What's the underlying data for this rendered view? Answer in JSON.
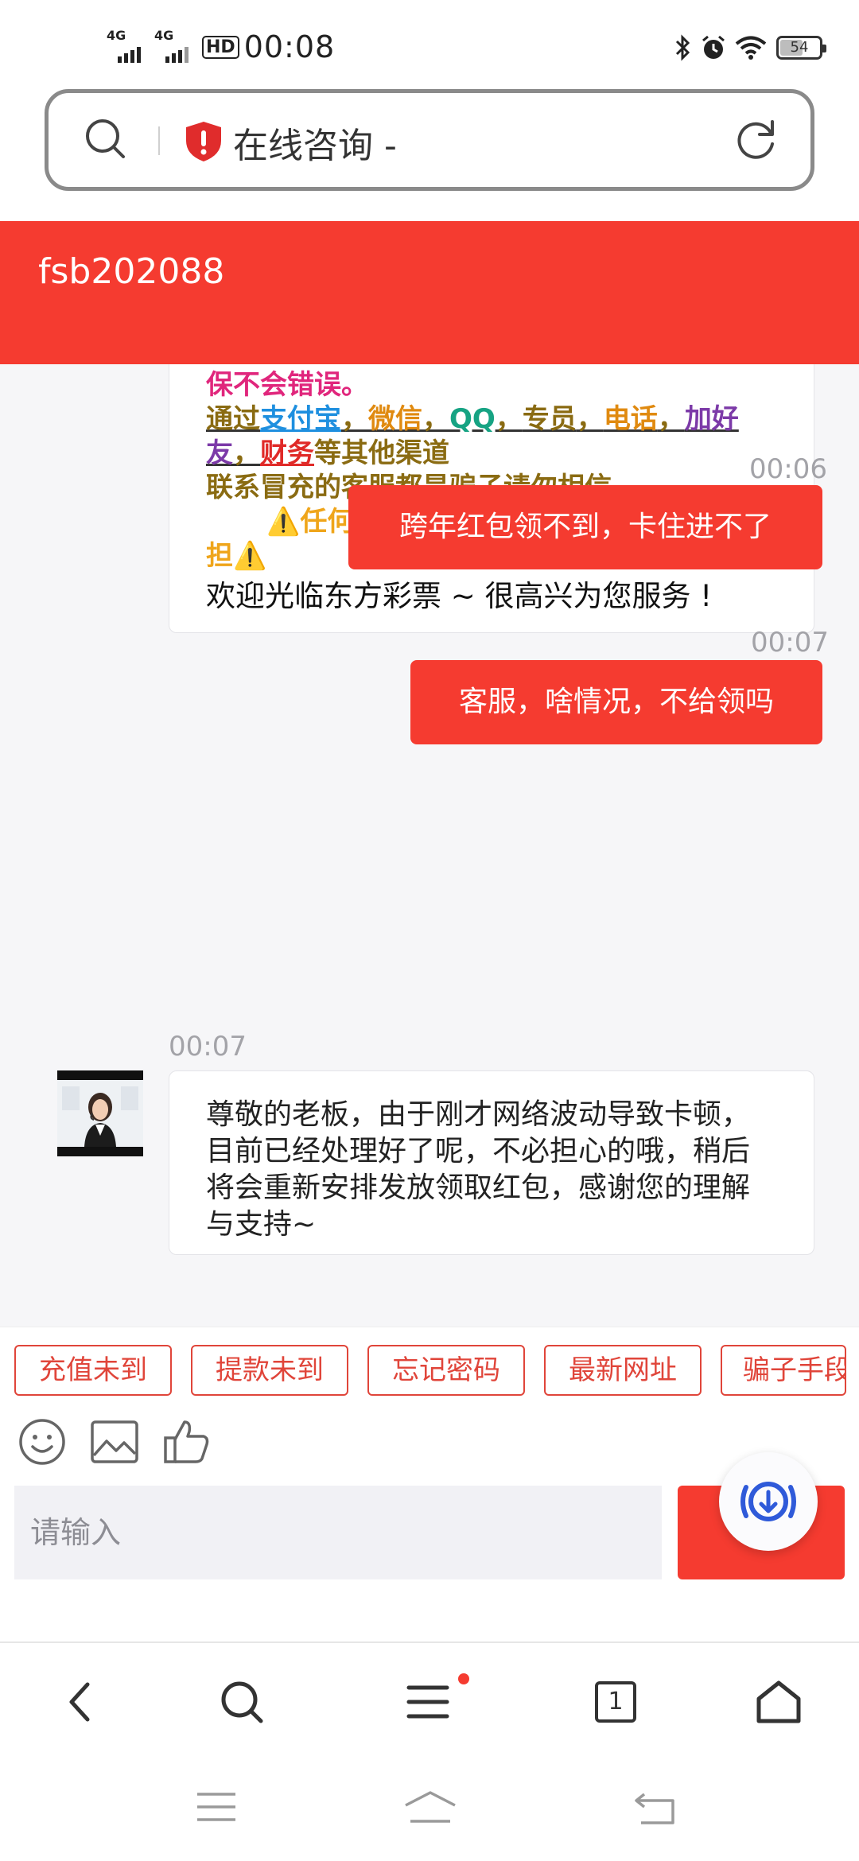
{
  "status_bar": {
    "signal1": "4G",
    "signal2": "4G",
    "hd": "HD",
    "time": "00:08",
    "battery": "54"
  },
  "browser": {
    "page_title": "在线咨询 -"
  },
  "chat_header": {
    "agent_name": "fsb202088"
  },
  "chat": {
    "notice": {
      "line1": "保不会错误。",
      "line2_a": "通过",
      "line2_alipay": "支付宝",
      "line2_sep1": "，",
      "line2_wechat": "微信",
      "line2_sep2": "，",
      "line2_qq": "QQ",
      "line2_sep3": "，",
      "line2_staff": "专员",
      "line2_sep4": "，",
      "line2_phone": "电话",
      "line2_sep5": "，",
      "line2_add": "加好",
      "line3_a": "友",
      "line3_sep": "，",
      "line3_finance": "财务",
      "line3_b": "等其他渠道",
      "line4": "联系冒充的客服都是骗子请勿相信",
      "line5": "⚠️任何双方私下交易造成的损失自行承",
      "line6": "担⚠️",
      "welcome": "欢迎光临东方彩票 ~ 很高兴为您服务 !"
    },
    "messages": [
      {
        "time": "00:06",
        "text": "跨年红包领不到，卡住进不了"
      },
      {
        "time": "00:07",
        "text": "客服，啥情况，不给领吗"
      },
      {
        "time": "00:07",
        "text": "尊敬的老板，由于刚才网络波动导致卡顿，目前已经处理好了呢，不必担心的哦，稍后将会重新安排发放领取红包，感谢您的理解与支持~"
      }
    ]
  },
  "quick_replies": [
    "充值未到",
    "提款未到",
    "忘记密码",
    "最新网址",
    "骗子手段"
  ],
  "input": {
    "placeholder": "请输入",
    "send_label": "发"
  },
  "toolbar": {
    "tab_count": "1"
  },
  "colors": {
    "brand_red": "#f53b30",
    "chat_bg": "#f6f6f8"
  },
  "icons": {
    "address_search": "search-icon",
    "security": "shield-alert-icon",
    "reload": "refresh-icon",
    "emoji": "emoji-icon",
    "image": "image-icon",
    "like": "thumbs-up-icon",
    "float": "download-floating-icon",
    "back": "chevron-left-icon",
    "search": "search-icon",
    "menu": "menu-icon",
    "tabs": "tabs-icon",
    "home": "home-icon"
  }
}
